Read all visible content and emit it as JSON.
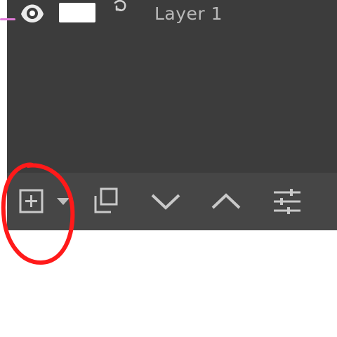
{
  "layer": {
    "name": "Layer 1",
    "visible_icon": "eye-icon",
    "link_icon": "link-icon"
  },
  "toolbar": {
    "buttons": [
      {
        "icon": "add-layer-icon"
      },
      {
        "icon": "dropdown-arrow-icon"
      },
      {
        "icon": "duplicate-layer-icon"
      },
      {
        "icon": "move-down-icon"
      },
      {
        "icon": "move-up-icon"
      },
      {
        "icon": "layer-properties-icon"
      }
    ]
  },
  "colors": {
    "panel_bg": "#3c3c3c",
    "toolbar_bg": "#464646",
    "icon": "#c9c9c9",
    "annotation": "#ff1a1a"
  }
}
